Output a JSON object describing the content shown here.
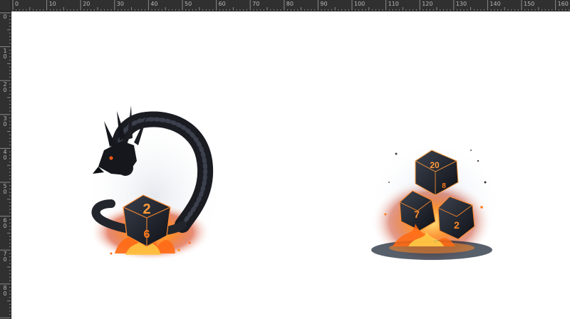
{
  "ruler": {
    "top_labels": [
      "0",
      "10",
      "20",
      "30",
      "40",
      "50",
      "60",
      "70",
      "80",
      "90",
      "100",
      "110",
      "120",
      "130",
      "140",
      "150",
      "160"
    ],
    "left_labels": [
      "0",
      "10",
      "20",
      "30",
      "40",
      "50",
      "60",
      "70",
      "80"
    ]
  },
  "canvas": {
    "artworks": [
      {
        "name": "dragon-with-d10-die",
        "icon": "dragon-die-fire-image"
      },
      {
        "name": "three-dice-on-fire",
        "icon": "dice-fire-image"
      }
    ],
    "die_faces": {
      "dragon_die_top": "2",
      "dragon_die_bottom": "6",
      "dice_top_die": "20",
      "dice_top_die_small": "8",
      "dice_left_die": "7",
      "dice_right_die": "2"
    }
  },
  "colors": {
    "ruler_bg": "#303030",
    "canvas_bg": "#ffffff",
    "fire": "#ff7a1a",
    "die_dark": "#1d1f26"
  }
}
